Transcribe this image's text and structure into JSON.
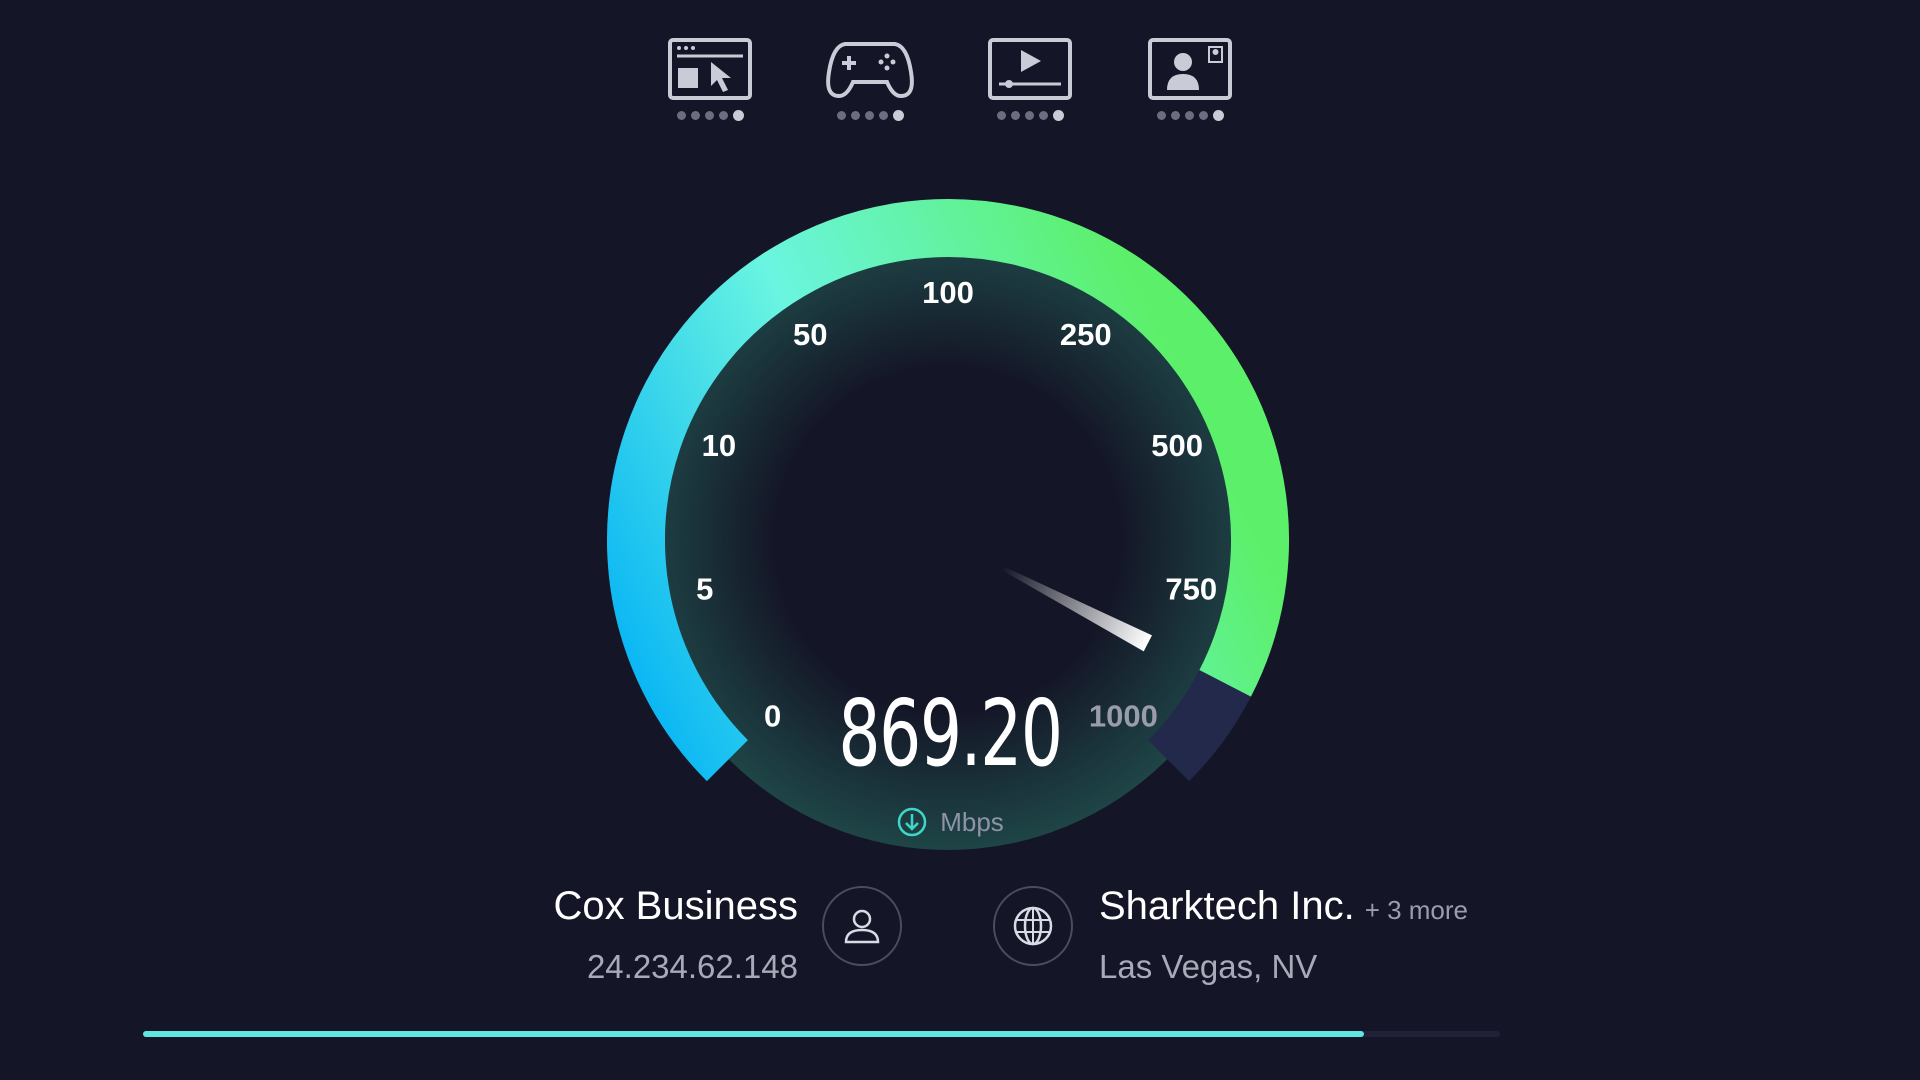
{
  "usage_icons": [
    {
      "name": "browsing-icon",
      "rating": 5,
      "max": 5
    },
    {
      "name": "gaming-icon",
      "rating": 5,
      "max": 5
    },
    {
      "name": "streaming-icon",
      "rating": 5,
      "max": 5
    },
    {
      "name": "video-chat-icon",
      "rating": 5,
      "max": 5
    }
  ],
  "gauge": {
    "ticks": [
      "0",
      "5",
      "10",
      "50",
      "100",
      "250",
      "500",
      "750",
      "1000"
    ],
    "tick_values": [
      0,
      5,
      10,
      50,
      100,
      250,
      500,
      750,
      1000
    ],
    "current_value": 869.2,
    "gradient_start": "#00b0f6",
    "gradient_mid": "#6af5e1",
    "gradient_end": "#5cf06a",
    "remaining_color": "#22294a"
  },
  "speed": {
    "value": "869.20",
    "unit": "Mbps",
    "direction_icon": "download-icon"
  },
  "isp": {
    "name": "Cox Business",
    "ip": "24.234.62.148",
    "icon": "user-icon"
  },
  "server": {
    "name": "Sharktech Inc.",
    "more": "+ 3 more",
    "location": "Las Vegas, NV",
    "icon": "globe-icon"
  },
  "progress": {
    "fraction": 0.9,
    "color": "#5ee6e3"
  }
}
